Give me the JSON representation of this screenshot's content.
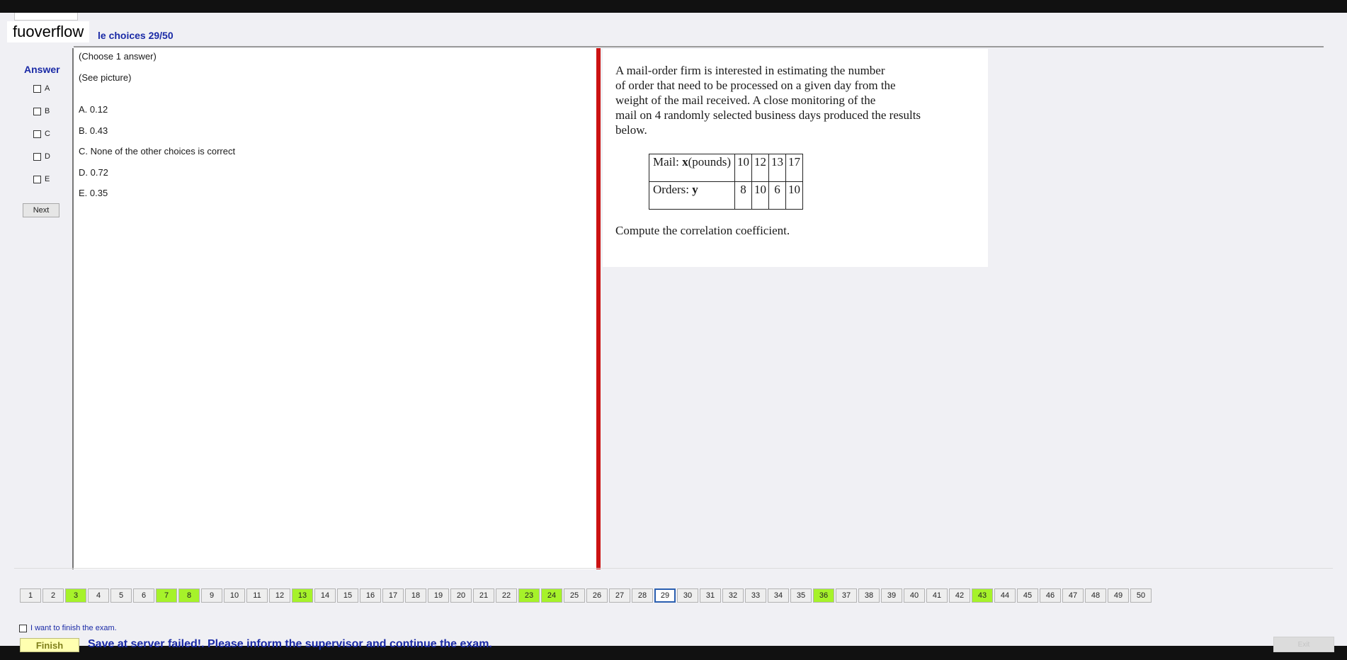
{
  "watermark": "fuoverflow",
  "header": {
    "title": "le choices 29/50"
  },
  "answer_panel": {
    "heading": "Answer",
    "options": [
      "A",
      "B",
      "C",
      "D",
      "E"
    ],
    "next_label": "Next"
  },
  "question_left": {
    "instruction": "(Choose 1 answer)",
    "see_picture": "(See picture)",
    "choices": [
      "A.  0.12",
      "B.  0.43",
      "C.  None of the other choices is correct",
      "D.  0.72",
      "E.  0.35"
    ]
  },
  "question_image": {
    "lines": [
      "A mail-order firm is interested in estimating the number",
      "of order that need to be processed on a given day from the",
      "weight of the mail received. A close monitoring of the",
      "mail on 4 randomly selected business days produced the results",
      "below."
    ],
    "table": {
      "row1": {
        "label_prefix": "Mail: ",
        "label_var": "x",
        "label_suffix": "(pounds)",
        "values": [
          "10",
          "12",
          "13",
          "17"
        ]
      },
      "row2": {
        "label_prefix": "Orders: ",
        "label_var": "y",
        "values": [
          "8",
          "10",
          "6",
          "10"
        ]
      }
    },
    "prompt": "Compute the correlation coefficient."
  },
  "pager": {
    "pages": [
      "1",
      "2",
      "3",
      "4",
      "5",
      "6",
      "7",
      "8",
      "9",
      "10",
      "11",
      "12",
      "13",
      "14",
      "15",
      "16",
      "17",
      "18",
      "19",
      "20",
      "21",
      "22",
      "23",
      "24",
      "25",
      "26",
      "27",
      "28",
      "29",
      "30",
      "31",
      "32",
      "33",
      "34",
      "35",
      "36",
      "37",
      "38",
      "39",
      "40",
      "41",
      "42",
      "43",
      "44",
      "45",
      "46",
      "47",
      "48",
      "49",
      "50"
    ],
    "answered": [
      "3",
      "7",
      "8",
      "13",
      "23",
      "24",
      "36",
      "43"
    ],
    "current": "29",
    "answered_color": "#a6f22a"
  },
  "footer": {
    "finish_checkbox_label": "I want to finish the exam.",
    "finish_label": "Finish",
    "status_message": "Save at server failed!. Please inform the supervisor and continue the exam.",
    "exit_label": "Exit"
  }
}
